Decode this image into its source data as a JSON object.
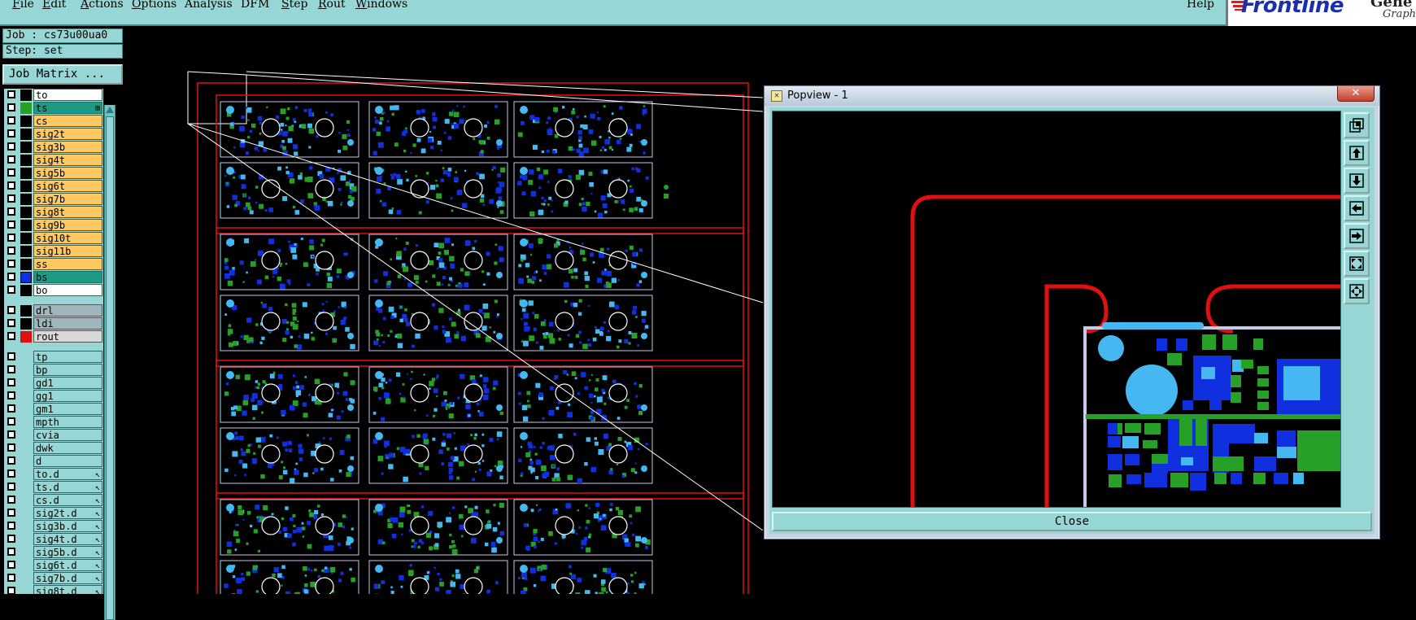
{
  "menubar": {
    "items": [
      {
        "label": "File",
        "ul": "F",
        "rest": "ile"
      },
      {
        "label": "Edit",
        "ul": "E",
        "rest": "dit"
      },
      {
        "label": "Actions",
        "ul": "A",
        "rest": "ctions"
      },
      {
        "label": "Options",
        "ul": "O",
        "rest": "ptions"
      },
      {
        "label": "Analysis",
        "ul": "",
        "rest": "Analysis"
      },
      {
        "label": "DFM",
        "ul": "",
        "rest": "DFM"
      },
      {
        "label": "Step",
        "ul": "S",
        "rest": "tep"
      },
      {
        "label": "Rout",
        "ul": "R",
        "rest": "out"
      },
      {
        "label": "Windows",
        "ul": "W",
        "rest": "indows"
      }
    ],
    "help": "Help"
  },
  "logo": {
    "brand": "Frontline",
    "right": "Gene",
    "sub": "Graphi"
  },
  "job": {
    "job_line": "Job : cs73u00ua0",
    "step_line": "Step: set",
    "matrix_button": "Job Matrix ..."
  },
  "layers": {
    "group1": [
      {
        "name": "to",
        "color": "#000000",
        "bg": "#ffffff"
      },
      {
        "name": "ts",
        "color": "#26a026",
        "bg": "#1e9a84",
        "mark": "⊞"
      },
      {
        "name": "cs",
        "color": "#000000",
        "bg": "#ffc860"
      },
      {
        "name": "sig2t",
        "color": "#000000",
        "bg": "#ffc860"
      },
      {
        "name": "sig3b",
        "color": "#000000",
        "bg": "#ffc860"
      },
      {
        "name": "sig4t",
        "color": "#000000",
        "bg": "#ffc860"
      },
      {
        "name": "sig5b",
        "color": "#000000",
        "bg": "#ffc860"
      },
      {
        "name": "sig6t",
        "color": "#000000",
        "bg": "#ffc860"
      },
      {
        "name": "sig7b",
        "color": "#000000",
        "bg": "#ffc860"
      },
      {
        "name": "sig8t",
        "color": "#000000",
        "bg": "#ffc860"
      },
      {
        "name": "sig9b",
        "color": "#000000",
        "bg": "#ffc860"
      },
      {
        "name": "sig10t",
        "color": "#000000",
        "bg": "#ffc860"
      },
      {
        "name": "sig11b",
        "color": "#000000",
        "bg": "#ffc860"
      },
      {
        "name": "ss",
        "color": "#000000",
        "bg": "#ffc860"
      },
      {
        "name": "bs",
        "color": "#1030e0",
        "bg": "#1e9a84"
      },
      {
        "name": "bo",
        "color": "#000000",
        "bg": "#ffffff"
      }
    ],
    "group2": [
      {
        "name": "drl",
        "color": "#000000",
        "bg": "#9fb6be"
      },
      {
        "name": "ldi",
        "color": "#000000",
        "bg": "#9fb6be"
      },
      {
        "name": "rout",
        "color": "#e01010",
        "bg": "#d8d8d8"
      }
    ],
    "group3": [
      {
        "name": "tp",
        "kind": ""
      },
      {
        "name": "bp",
        "kind": ""
      },
      {
        "name": "gd1",
        "kind": ""
      },
      {
        "name": "gg1",
        "kind": ""
      },
      {
        "name": "gm1",
        "kind": ""
      },
      {
        "name": "mpth",
        "kind": ""
      },
      {
        "name": "cvia",
        "kind": ""
      },
      {
        "name": "dwk",
        "kind": ""
      },
      {
        "name": "d",
        "kind": ""
      },
      {
        "name": "to.d",
        "kind": "drillout"
      },
      {
        "name": "ts.d",
        "kind": "drillout"
      },
      {
        "name": "cs.d",
        "kind": "drillout"
      },
      {
        "name": "sig2t.d",
        "kind": "drillout"
      },
      {
        "name": "sig3b.d",
        "kind": "drillout"
      },
      {
        "name": "sig4t.d",
        "kind": "drillout"
      },
      {
        "name": "sig5b.d",
        "kind": "drillout"
      },
      {
        "name": "sig6t.d",
        "kind": "drillout"
      },
      {
        "name": "sig7b.d",
        "kind": "drillout"
      },
      {
        "name": "sig8t.d",
        "kind": "drillout"
      }
    ]
  },
  "colors": {
    "ui_cyan": "#96d7d5",
    "rout": "#e01010",
    "copper_top": "#26a026",
    "copper_bottom": "#1030e0",
    "pad_light": "#45b8f2",
    "outline": "#c8c8e8"
  },
  "popview": {
    "title": "Popview - 1",
    "close_x": "✕",
    "close_button": "Close",
    "tools": [
      "zoom-fit-icon",
      "pan-up-icon",
      "pan-down-icon",
      "pan-left-icon",
      "pan-right-icon",
      "zoom-home-icon",
      "zoom-all-icon"
    ]
  }
}
